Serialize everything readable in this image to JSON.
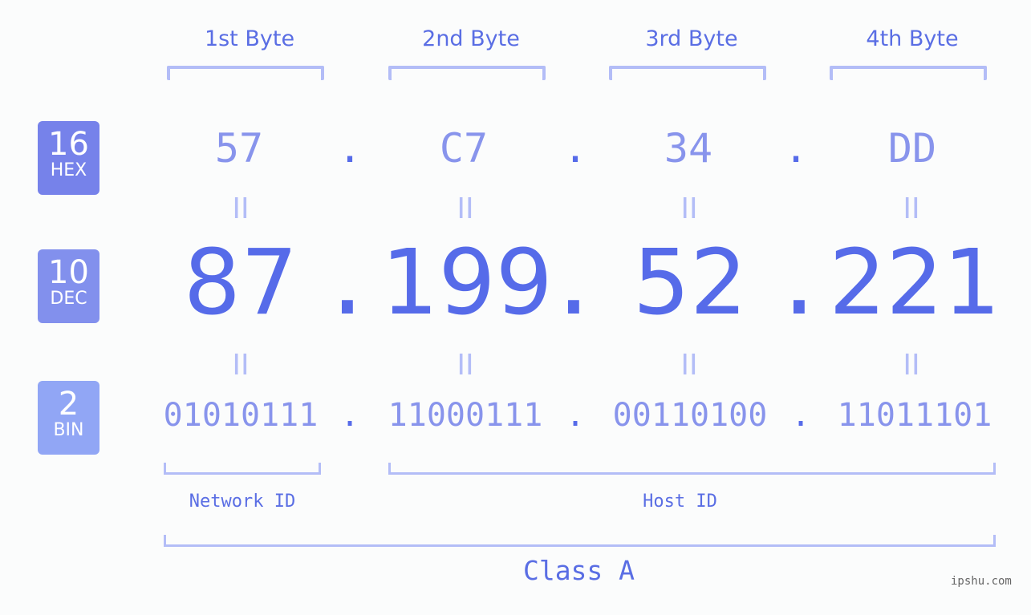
{
  "bytes": [
    {
      "label": "1st Byte",
      "hex": "57",
      "dec": "87",
      "bin": "01010111"
    },
    {
      "label": "2nd Byte",
      "hex": "C7",
      "dec": "199",
      "bin": "11000111"
    },
    {
      "label": "3rd Byte",
      "hex": "34",
      "dec": "52",
      "bin": "00110100"
    },
    {
      "label": "4th Byte",
      "hex": "DD",
      "dec": "221",
      "bin": "11011101"
    }
  ],
  "badges": {
    "hex": {
      "base": "16",
      "name": "HEX",
      "color": "#7682ea"
    },
    "dec": {
      "base": "10",
      "name": "DEC",
      "color": "#8290ed"
    },
    "bin": {
      "base": "2",
      "name": "BIN",
      "color": "#91a6f5"
    }
  },
  "separator": ".",
  "equals": "II",
  "network_id_label": "Network ID",
  "host_id_label": "Host ID",
  "class_label": "Class A",
  "watermark": "ipshu.com"
}
